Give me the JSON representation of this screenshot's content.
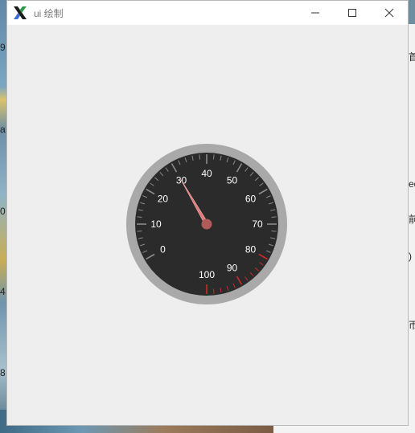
{
  "window": {
    "title": "ui 绘制",
    "app_icon": "x-logo-icon",
    "controls": {
      "minimize_icon": "minimize-icon",
      "maximize_icon": "maximize-icon",
      "close_icon": "close-icon"
    }
  },
  "gauge": {
    "min": 0,
    "max": 100,
    "value": 30,
    "tick_labels": [
      "0",
      "10",
      "20",
      "30",
      "40",
      "50",
      "60",
      "70",
      "80",
      "90",
      "100"
    ],
    "danger_zone_start": 80,
    "colors": {
      "ring": "#a9a9a9",
      "dial": "#2b2b2b",
      "ticks": "#8a8a8a",
      "danger": "#cc2a2a",
      "needle": "#e07a7a",
      "hub": "#b05a5a",
      "label": "#ffffff"
    }
  },
  "background_edge_text": {
    "left_labels": [
      "9",
      "a",
      "0",
      "4",
      "8"
    ],
    "right_labels": [
      "首",
      "ed",
      "前",
      ")",
      "帀"
    ]
  }
}
